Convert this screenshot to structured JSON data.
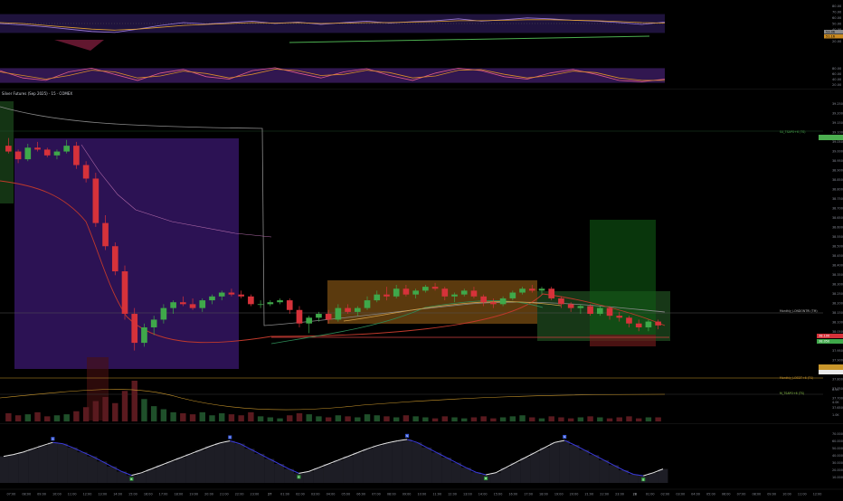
{
  "chart_data": [
    {
      "type": "line",
      "panel": "rsi-oscillator",
      "ylim": [
        0,
        100
      ],
      "y_ticks": [
        "80.00",
        "70.00",
        "60.00",
        "50.00",
        "40.00",
        "30.00",
        "20.00"
      ],
      "band": [
        30,
        70
      ],
      "band_color": "#2a1a52",
      "x": [
        0,
        10,
        20,
        30,
        40,
        50,
        60,
        70,
        80,
        90,
        100,
        110,
        120,
        130,
        140,
        150,
        160,
        170,
        180,
        190,
        200,
        210,
        220,
        230,
        240,
        250,
        260,
        270,
        280,
        290
      ],
      "series": [
        {
          "color": "#9c7bd9",
          "values": [
            50,
            47,
            43,
            38,
            33,
            31,
            38,
            46,
            52,
            49,
            52,
            55,
            50,
            53,
            48,
            52,
            55,
            51,
            54,
            56,
            60,
            55,
            58,
            62,
            60,
            57,
            55,
            52,
            48,
            53
          ]
        },
        {
          "color": "#e0a030",
          "values": [
            52,
            50,
            46,
            42,
            38,
            36,
            38,
            42,
            46,
            48,
            50,
            52,
            51,
            52,
            50,
            51,
            52,
            52,
            53,
            54,
            56,
            56,
            57,
            58,
            58,
            57,
            56,
            54,
            52,
            51
          ]
        }
      ],
      "y_value_labels": [
        "53.06",
        "51.16"
      ]
    },
    {
      "type": "line",
      "panel": "stoch-oscillator",
      "ylim": [
        0,
        100
      ],
      "y_ticks": [
        "80.00",
        "60.00",
        "40.00",
        "20.00"
      ],
      "band": [
        20,
        80
      ],
      "band_color": "#3a1b5e",
      "x": [
        0,
        10,
        20,
        30,
        40,
        50,
        60,
        70,
        80,
        90,
        100,
        110,
        120,
        130,
        140,
        150,
        160,
        170,
        180,
        190,
        200,
        210,
        220,
        230,
        240,
        250,
        260,
        270,
        280,
        290
      ],
      "series": [
        {
          "color": "#e05a8a",
          "values": [
            70,
            40,
            30,
            65,
            80,
            55,
            30,
            60,
            75,
            45,
            35,
            70,
            82,
            60,
            40,
            65,
            78,
            50,
            30,
            60,
            80,
            70,
            45,
            35,
            60,
            75,
            55,
            30,
            25,
            35
          ]
        },
        {
          "color": "#d98c2b",
          "values": [
            65,
            50,
            35,
            50,
            72,
            65,
            40,
            48,
            68,
            58,
            40,
            55,
            76,
            70,
            50,
            55,
            72,
            62,
            40,
            48,
            72,
            74,
            55,
            40,
            50,
            68,
            62,
            40,
            30,
            30
          ]
        }
      ]
    },
    {
      "type": "candlestick",
      "panel": "price",
      "title": "Silver Futures (Sep 2025) · 15 · COMEX",
      "ylim": [
        37.64,
        39.25
      ],
      "y_ticks": [
        "39.250",
        "39.200",
        "39.150",
        "39.100",
        "39.050",
        "39.000",
        "38.950",
        "38.900",
        "38.850",
        "38.800",
        "38.750",
        "38.700",
        "38.650",
        "38.600",
        "38.550",
        "38.500",
        "38.450",
        "38.400",
        "38.350",
        "38.300",
        "38.250",
        "38.200",
        "38.150",
        "38.100",
        "38.050",
        "38.000",
        "37.950",
        "37.900",
        "37.850",
        "37.800",
        "37.750",
        "37.700",
        "37.650"
      ],
      "x_ticks": [
        "07:00",
        "08:00",
        "09:00",
        "10:00",
        "11:00",
        "12:00",
        "13:00",
        "14:00",
        "15:00",
        "16:00",
        "17:00",
        "18:00",
        "19:00",
        "20:00",
        "21:00",
        "22:00",
        "23:00",
        "27",
        "01:00",
        "02:00",
        "03:00",
        "04:00",
        "05:00",
        "06:00",
        "07:00",
        "08:00",
        "09:00",
        "10:00",
        "11:00",
        "12:00",
        "13:00",
        "14:00",
        "15:00",
        "16:00",
        "17:00",
        "18:00",
        "19:00",
        "20:00",
        "21:00",
        "22:00",
        "23:00",
        "28",
        "01:00",
        "02:00",
        "03:00",
        "04:00",
        "05:00",
        "06:00",
        "07:00",
        "08:00",
        "09:00",
        "10:00",
        "11:00",
        "12:00"
      ],
      "candles": [
        [
          39.02,
          39.06,
          38.98,
          38.99
        ],
        [
          38.99,
          39.0,
          38.93,
          38.95
        ],
        [
          38.95,
          39.03,
          38.94,
          39.01
        ],
        [
          39.01,
          39.04,
          38.99,
          39.0
        ],
        [
          39.0,
          39.01,
          38.96,
          38.97
        ],
        [
          38.97,
          39.0,
          38.95,
          38.99
        ],
        [
          38.99,
          39.05,
          38.98,
          39.02
        ],
        [
          39.02,
          39.04,
          38.9,
          38.92
        ],
        [
          38.92,
          38.94,
          38.83,
          38.85
        ],
        [
          38.85,
          38.88,
          38.6,
          38.62
        ],
        [
          38.62,
          38.66,
          38.48,
          38.5
        ],
        [
          38.5,
          38.52,
          38.35,
          38.37
        ],
        [
          38.37,
          38.4,
          38.12,
          38.15
        ],
        [
          38.15,
          38.18,
          37.96,
          38.0
        ],
        [
          38.0,
          38.1,
          37.98,
          38.08
        ],
        [
          38.08,
          38.14,
          38.04,
          38.12
        ],
        [
          38.12,
          38.2,
          38.1,
          38.18
        ],
        [
          38.18,
          38.22,
          38.15,
          38.21
        ],
        [
          38.21,
          38.24,
          38.19,
          38.2
        ],
        [
          38.2,
          38.23,
          38.17,
          38.18
        ],
        [
          38.18,
          38.23,
          38.16,
          38.22
        ],
        [
          38.22,
          38.25,
          38.2,
          38.24
        ],
        [
          38.24,
          38.27,
          38.22,
          38.26
        ],
        [
          38.26,
          38.28,
          38.24,
          38.25
        ],
        [
          38.25,
          38.27,
          38.23,
          38.24
        ],
        [
          38.24,
          38.25,
          38.19,
          38.2
        ],
        [
          38.2,
          38.22,
          38.18,
          38.2
        ],
        [
          38.2,
          38.22,
          38.19,
          38.21
        ],
        [
          38.21,
          38.23,
          38.2,
          38.22
        ],
        [
          38.22,
          38.23,
          38.15,
          38.17
        ],
        [
          38.17,
          38.19,
          38.08,
          38.1
        ],
        [
          38.1,
          38.14,
          38.05,
          38.13
        ],
        [
          38.13,
          38.16,
          38.11,
          38.15
        ],
        [
          38.15,
          38.17,
          38.1,
          38.12
        ],
        [
          38.12,
          38.2,
          38.11,
          38.18
        ],
        [
          38.18,
          38.2,
          38.15,
          38.16
        ],
        [
          38.16,
          38.19,
          38.14,
          38.18
        ],
        [
          38.18,
          38.24,
          38.17,
          38.22
        ],
        [
          38.22,
          38.27,
          38.21,
          38.25
        ],
        [
          38.25,
          38.29,
          38.22,
          38.24
        ],
        [
          38.24,
          38.3,
          38.23,
          38.28
        ],
        [
          38.28,
          38.3,
          38.24,
          38.25
        ],
        [
          38.25,
          38.28,
          38.23,
          38.27
        ],
        [
          38.27,
          38.3,
          38.26,
          38.29
        ],
        [
          38.29,
          38.31,
          38.27,
          38.28
        ],
        [
          38.28,
          38.29,
          38.22,
          38.24
        ],
        [
          38.24,
          38.26,
          38.21,
          38.25
        ],
        [
          38.25,
          38.28,
          38.24,
          38.27
        ],
        [
          38.27,
          38.29,
          38.23,
          38.24
        ],
        [
          38.24,
          38.25,
          38.19,
          38.21
        ],
        [
          38.21,
          38.23,
          38.18,
          38.2
        ],
        [
          38.2,
          38.24,
          38.19,
          38.23
        ],
        [
          38.23,
          38.27,
          38.22,
          38.26
        ],
        [
          38.26,
          38.29,
          38.25,
          38.28
        ],
        [
          38.28,
          38.3,
          38.26,
          38.27
        ],
        [
          38.27,
          38.29,
          38.25,
          38.28
        ],
        [
          38.28,
          38.29,
          38.22,
          38.23
        ],
        [
          38.23,
          38.24,
          38.18,
          38.2
        ],
        [
          38.2,
          38.21,
          38.16,
          38.18
        ],
        [
          38.18,
          38.2,
          38.15,
          38.19
        ],
        [
          38.19,
          38.2,
          38.14,
          38.15
        ],
        [
          38.15,
          38.19,
          38.14,
          38.18
        ],
        [
          38.18,
          38.19,
          38.12,
          38.14
        ],
        [
          38.14,
          38.16,
          38.11,
          38.13
        ],
        [
          38.13,
          38.14,
          38.08,
          38.1
        ],
        [
          38.1,
          38.12,
          38.06,
          38.08
        ],
        [
          38.08,
          38.12,
          38.06,
          38.11
        ],
        [
          38.11,
          38.12,
          38.07,
          38.09
        ]
      ],
      "price_labels": [
        "38.100",
        "38.050"
      ],
      "annotations": [
        "Monthly_LONDONTRI (TM)",
        "Monthly_LOEDT+6 (TS)",
        "M_TSAPO+6 (TS)",
        "S4_TSAPO+6 (TS)"
      ]
    },
    {
      "type": "bar",
      "panel": "volume",
      "values": [
        8,
        6,
        7,
        9,
        5,
        6,
        7,
        10,
        14,
        20,
        24,
        18,
        30,
        40,
        22,
        15,
        12,
        9,
        8,
        7,
        9,
        6,
        8,
        7,
        6,
        9,
        5,
        4,
        3,
        6,
        8,
        7,
        5,
        4,
        6,
        5,
        4,
        7,
        6,
        5,
        4,
        6,
        5,
        4,
        3,
        5,
        4,
        3,
        4,
        5,
        3,
        4,
        5,
        6,
        4,
        3,
        5,
        4,
        3,
        4,
        5,
        4,
        3,
        4,
        5,
        3,
        4,
        4
      ],
      "y_ticks": [
        "8.5K",
        "4.0K",
        "1.0K"
      ]
    },
    {
      "type": "area",
      "panel": "momentum",
      "ylim": [
        -100,
        100
      ],
      "y_ticks": [
        "70.000",
        "60.000",
        "50.000",
        "40.000",
        "30.000",
        "20.000",
        "10.000"
      ],
      "values": [
        5,
        12,
        22,
        35,
        48,
        60,
        55,
        40,
        22,
        5,
        -15,
        -35,
        -55,
        -70,
        -60,
        -45,
        -30,
        -15,
        0,
        15,
        30,
        45,
        58,
        66,
        55,
        35,
        15,
        -5,
        -25,
        -45,
        -62,
        -55,
        -40,
        -25,
        -10,
        5,
        20,
        35,
        48,
        58,
        66,
        72,
        60,
        40,
        20,
        0,
        -20,
        -40,
        -58,
        -68,
        -60,
        -40,
        -20,
        0,
        20,
        40,
        60,
        68,
        50,
        30,
        10,
        -10,
        -30,
        -50,
        -66,
        -72,
        -60,
        -45
      ],
      "markers": [
        "S",
        "B",
        "S",
        "B",
        "S",
        "B",
        "S",
        "B",
        "S",
        "B"
      ]
    }
  ]
}
